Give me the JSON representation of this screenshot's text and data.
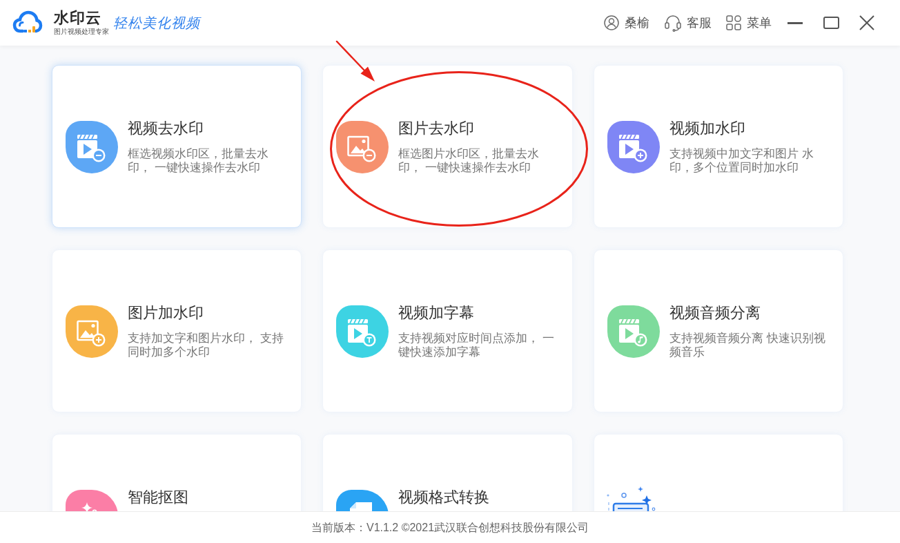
{
  "header": {
    "logo": {
      "name": "水印云",
      "tagline": "图片视频处理专家"
    },
    "slogan": "轻松美化视频",
    "user": {
      "label": "桑榆"
    },
    "support": {
      "label": "客服"
    },
    "menu": {
      "label": "菜单"
    }
  },
  "cards": [
    {
      "kind": "tool",
      "title": "视频去水印",
      "description": "框选视频水印区，批量去水印， 一键快速操作去水印",
      "color": "#5da7f5",
      "selected": true,
      "circled": false
    },
    {
      "kind": "tool",
      "title": "图片去水印",
      "description": "框选图片水印区，批量去水印， 一键快速操作去水印",
      "color": "#f6916f",
      "selected": false,
      "circled": true
    },
    {
      "kind": "tool",
      "title": "视频加水印",
      "description": "支持视频中加文字和图片 水印，多个位置同时加水印",
      "color": "#7f86f5",
      "selected": false,
      "circled": false
    },
    {
      "kind": "tool",
      "title": "图片加水印",
      "description": "支持加文字和图片水印， 支持同时加多个水印",
      "color": "#f8b447",
      "selected": false,
      "circled": false
    },
    {
      "kind": "tool",
      "title": "视频加字幕",
      "description": "支持视频对应时间点添加， 一键快速添加字幕",
      "color": "#3dd3e3",
      "selected": false,
      "circled": false
    },
    {
      "kind": "tool",
      "title": "视频音频分离",
      "description": "支持视频音频分离 快速识别视频音乐",
      "color": "#7edb9c",
      "selected": false,
      "circled": false
    },
    {
      "kind": "tool",
      "title": "智能抠图",
      "color": "#fb7ea6",
      "selected": false,
      "circled": false
    },
    {
      "kind": "tool",
      "title": "视频格式转换",
      "color": "#2aa4f4",
      "selected": false,
      "circled": false
    },
    {
      "kind": "banner",
      "selected": false,
      "circled": false
    }
  ],
  "footer": {
    "text": "当前版本：V1.1.2 ©2021武汉联合创想科技股份有限公司"
  }
}
